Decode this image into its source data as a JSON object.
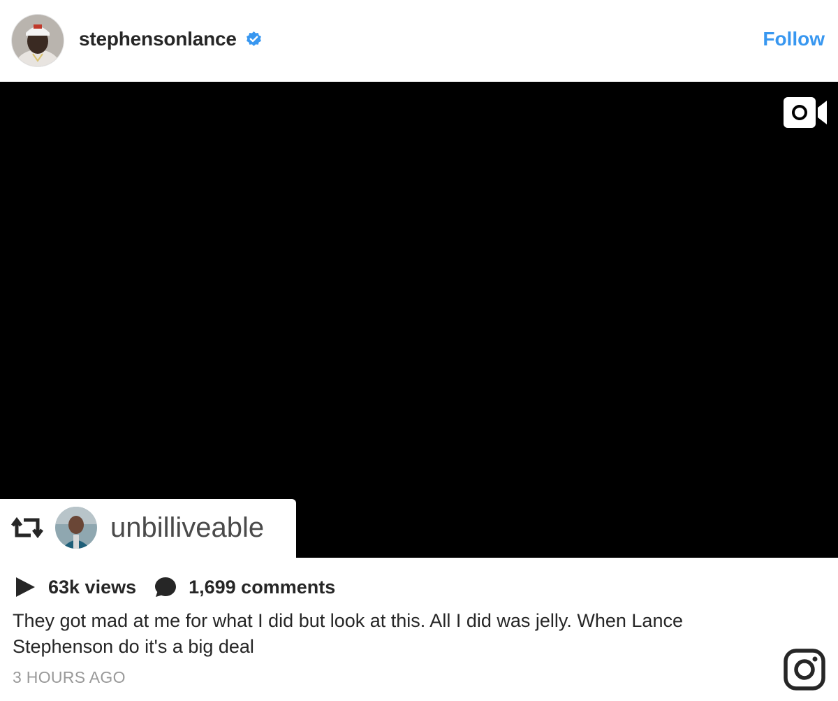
{
  "post": {
    "username": "stephensonlance",
    "follow_label": "Follow",
    "icons": {
      "avatar": "profile-photo",
      "verified": "verified-badge-icon",
      "video": "video-camera-icon",
      "repost": "repost-icon",
      "views": "play-icon",
      "comments": "comment-bubble-icon",
      "brand": "instagram-icon"
    },
    "colors": {
      "accent": "#3897f0",
      "text": "#262626",
      "muted": "#999999",
      "video_bg": "#000000"
    }
  },
  "repost": {
    "username": "unbilliveable"
  },
  "stats": {
    "views": "63k views",
    "comments": "1,699 comments"
  },
  "caption": "They got mad at me for what I did but look at this. All I did was jelly. When Lance Stephenson do it's a big deal",
  "timestamp": "3 HOURS AGO"
}
